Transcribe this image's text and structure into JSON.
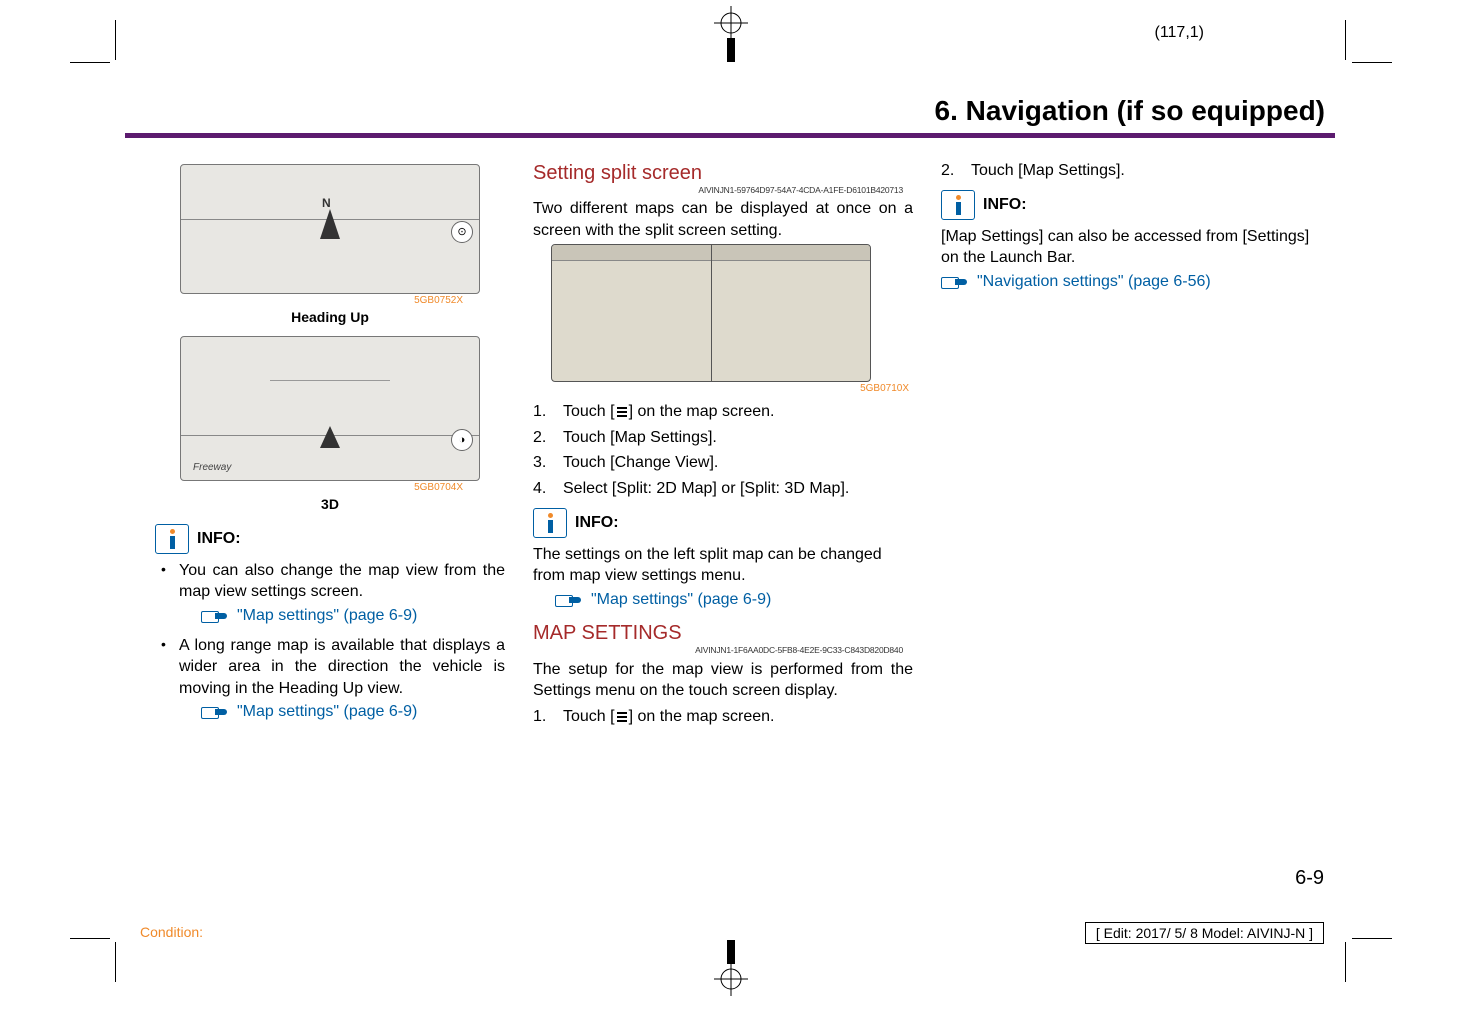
{
  "page_coord": "(117,1)",
  "chapter_title": "6. Navigation (if so equipped)",
  "col1": {
    "img_heading_up": {
      "id": "5GB0752X",
      "caption": "Heading Up"
    },
    "img_3d": {
      "id": "5GB0704X",
      "caption": "3D"
    },
    "info_label": "INFO:",
    "bullets": [
      {
        "text": "You can also change the map view from the map view settings screen.",
        "xref": "\"Map settings\" (page 6-9)"
      },
      {
        "text": "A long range map is available that displays a wider area in the direction the vehicle is moving in the Heading Up view.",
        "xref": "\"Map settings\" (page 6-9)"
      }
    ]
  },
  "col2": {
    "h_split": "Setting split screen",
    "guid_split": "AIVINJN1-59764D97-54A7-4CDA-A1FE-D6101B420713",
    "p_split_intro": "Two different maps can be displayed at once on a screen with the split screen setting.",
    "img_split": {
      "id": "5GB0710X"
    },
    "steps": [
      {
        "pre": "Touch [",
        "icon": true,
        "post": "] on the map screen."
      },
      {
        "pre": "Touch [Map Settings]."
      },
      {
        "pre": "Touch [Change View]."
      },
      {
        "pre": "Select [Split: 2D Map] or [Split: 3D Map]."
      }
    ],
    "info_label": "INFO:",
    "p_split_note": "The settings on the left split map can be changed from map view settings menu.",
    "xref_split": "\"Map settings\" (page 6-9)",
    "h_mapset": "MAP SETTINGS",
    "guid_mapset": "AIVINJN1-1F6AA0DC-5FB8-4E2E-9C33-C843D820D840",
    "p_mapset": "The setup for the map view is performed from the Settings menu on the touch screen display.",
    "step_mapset_pre": "Touch [",
    "step_mapset_post": "] on the map screen."
  },
  "col3": {
    "step2": "Touch [Map Settings].",
    "info_label": "INFO:",
    "p1": "[Map Settings] can also be accessed from [Settings] on the Launch Bar.",
    "xref": "\"Navigation settings\" (page 6-56)"
  },
  "footer": {
    "page_num": "6-9",
    "condition": "Condition:",
    "edit": "[ Edit: 2017/ 5/ 8    Model:  AIVINJ-N ]"
  }
}
